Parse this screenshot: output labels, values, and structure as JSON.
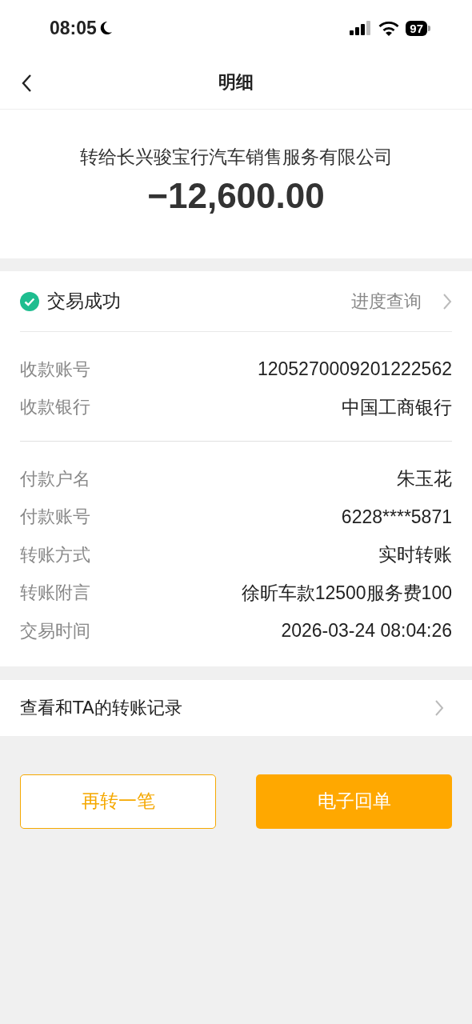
{
  "status_bar": {
    "time": "08:05",
    "battery": "97"
  },
  "nav": {
    "title": "明细"
  },
  "summary": {
    "payee": "转给长兴骏宝行汽车销售服务有限公司",
    "amount": "−12,600.00"
  },
  "status": {
    "label": "交易成功",
    "link": "进度查询"
  },
  "groups": [
    [
      {
        "label": "收款账号",
        "value": "1205270009201222562"
      },
      {
        "label": "收款银行",
        "value": "中国工商银行"
      }
    ],
    [
      {
        "label": "付款户名",
        "value": "朱玉花"
      },
      {
        "label": "付款账号",
        "value": "6228****5871"
      },
      {
        "label": "转账方式",
        "value": "实时转账"
      },
      {
        "label": "转账附言",
        "value": "徐昕车款12500服务费100"
      },
      {
        "label": "交易时间",
        "value": "2026-03-24 08:04:26"
      }
    ]
  ],
  "record_link": "查看和TA的转账记录",
  "buttons": [
    {
      "label": "再转一笔",
      "kind": "outline"
    },
    {
      "label": "电子回单",
      "kind": "primary"
    }
  ]
}
